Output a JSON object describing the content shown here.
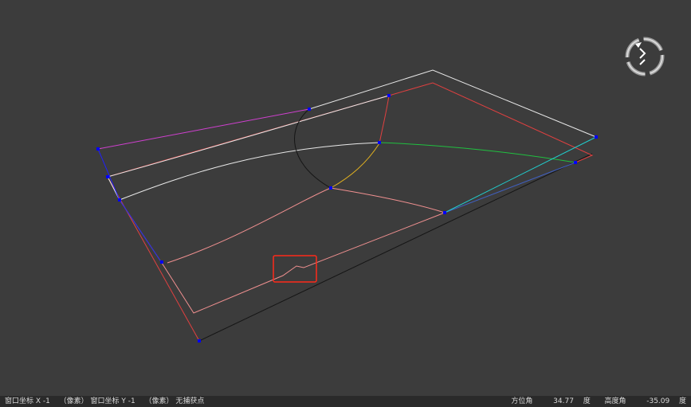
{
  "status": {
    "window_x_label": "窗口坐标 X",
    "window_x_value": "-1",
    "pixel_unit_1": "（像素）",
    "window_y_label": "窗口坐标 Y",
    "window_y_value": "-1",
    "pixel_unit_2": "（像素）",
    "capture_state": "无捕获点",
    "azimuth_label": "方位角",
    "azimuth_value": "34.77",
    "azimuth_unit": "度",
    "elevation_label": "高度角",
    "elevation_value": "-35.09",
    "elevation_unit": "度"
  },
  "colors": {
    "background": "#3c3c3c",
    "status_bar": "#2a2a2a",
    "control_point": "#0000ff",
    "highlight_box": "#ff2a1a",
    "curve_white": "#e8e8e8",
    "curve_red": "#e04040",
    "curve_pink": "#f09090",
    "curve_magenta": "#d040d0",
    "curve_green": "#20c040",
    "curve_cyan": "#20d0d0",
    "curve_yellow": "#e0b020",
    "curve_black": "#151515",
    "curve_blue": "#2020ff"
  },
  "icons": {
    "view_rotation": "rotate-view-icon"
  }
}
